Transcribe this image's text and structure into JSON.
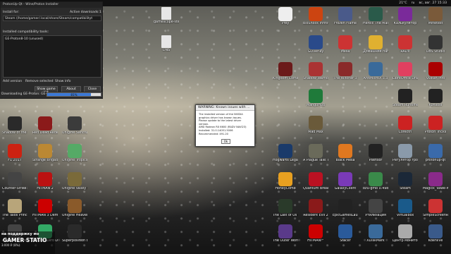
{
  "topbar": {
    "temp": "21°C",
    "lang": "ru",
    "datetime": "вс, авг. 27 15:33"
  },
  "installer": {
    "title": "ProtonUp-Qt - Wine/Proton Installer",
    "install_for_label": "Install for:",
    "install_for_value": "Steam (/home/gamer/.local/share/Steam/compatibilityt",
    "active_downloads_label": "Active downloads:",
    "active_downloads_value": "1",
    "installed_label": "Installed compatibility tools:",
    "installed_items": [
      "GE-Proton8-10 (unused)"
    ],
    "buttons": {
      "add": "Add version",
      "remove": "Remove selected",
      "info": "Show info",
      "game_list": "Show game list",
      "about": "About",
      "close": "Close"
    },
    "progress": {
      "text": "Downloading GE-Proton: GE-Pro",
      "percent": "81%",
      "value": 0.81
    }
  },
  "dialog": {
    "title": "WARNING: Known issues with ...",
    "body_1": "The installed version of the NVIDIA graphics driver has known issues.",
    "body_2": "Please update to the latest driver version.",
    "body_3": "AMD Radeon RX 6600 (RADV NAVI23)",
    "body_4": "Installed: 31.0.14051.5006",
    "body_5": "Recommended: 491.20",
    "ok": "Ok"
  },
  "files": [
    "gamescope-steam",
    "DNS"
  ],
  "icons_left": [
    {
      "label": "Shadow of the Tomb Raider",
      "color": "#2a2a2a"
    },
    {
      "label": "Red Dead Redemption 2",
      "color": "#8b1a1a"
    },
    {
      "label": "Unigine Sanctuary Benchmark",
      "color": "#3b3b3b"
    },
    {
      "label": "F1 2017",
      "color": "#c21"
    },
    {
      "label": "Strange Brigade",
      "color": "#b83"
    },
    {
      "label": "Unigine Tropics Benchmark",
      "color": "#5a6"
    },
    {
      "label": "Counter-Strike: Global Offensive",
      "color": "#444"
    },
    {
      "label": "HITMAN 2",
      "color": "#b11"
    },
    {
      "label": "Unigine Valley Benchmark",
      "color": "#7a6a3a"
    },
    {
      "label": "The Talos Principle",
      "color": "#b8a57a"
    },
    {
      "label": "HITMAN 3 Demo",
      "color": "#c00"
    },
    {
      "label": "Unigine Heaven Benchmark",
      "color": "#8a5a2a"
    },
    {
      "label": "Assassin's Creed Origins",
      "color": "#444"
    },
    {
      "label": "Horizon Zero Dawn",
      "color": "#3a6"
    },
    {
      "label": "Superposition Benchmark",
      "color": "#2a2a2a"
    }
  ],
  "icons_mid": [
    {
      "label": "Prey",
      "color": "#eee"
    },
    {
      "label": "BioShock Infinite",
      "color": "#c41"
    },
    {
      "label": "Frozen Flame",
      "color": "#4a5a8a"
    },
    {
      "label": "GOverlay",
      "color": "#2a4a8a"
    },
    {
      "label": "Mesa",
      "color": "#c33"
    },
    {
      "label": "Kingdom Come: Deliverance",
      "color": "#6b1a1a"
    },
    {
      "label": "Shadow Warrior 2",
      "color": "#a33"
    },
    {
      "label": "The Witcher 3",
      "color": "#8a2a2a"
    },
    {
      "label": "MangoHud",
      "color": "#1f7a3a"
    },
    {
      "label": "Mad Max",
      "color": "#6a5a3a"
    },
    {
      "label": "Hogwarts Legacy",
      "color": "#1a3a6a"
    },
    {
      "label": "A Plague Tale: Innocence",
      "color": "#6a6a5a"
    },
    {
      "label": "Black Mesa",
      "color": "#e07820"
    },
    {
      "label": "HoneyComb",
      "color": "#e8a020"
    },
    {
      "label": "Quantum Break",
      "color": "#b12"
    },
    {
      "label": "GalaxyClient",
      "color": "#7a3ab8"
    },
    {
      "label": "The Last of Us Part I",
      "color": "#2a3a2a"
    },
    {
      "label": "Resident Evil 2",
      "color": "#8a1a1a"
    },
    {
      "label": "EpicGamesLauncher",
      "color": "#222"
    },
    {
      "label": "The Outer Worlds: Spacer's",
      "color": "#5a3a8a"
    },
    {
      "label": "HITMAN™",
      "color": "#c00"
    },
    {
      "label": "Stacer",
      "color": "#2a5a9a"
    }
  ],
  "icons_right": [
    {
      "label": "Heroic The Master Chief Collection",
      "color": "#2a5a4a"
    },
    {
      "label": "Калькулятор",
      "color": "#7a2a9a"
    },
    {
      "label": "Minetest",
      "color": "#7a5a3a"
    },
    {
      "label": "Домашняя папка",
      "color": "#e0b030"
    },
    {
      "label": "RADV",
      "color": "#c33"
    },
    {
      "label": "OBS Studio",
      "color": "#333"
    },
    {
      "label": "AntiMicroX 3.3",
      "color": "#3a6a9a"
    },
    {
      "label": "LibreOffice Draw",
      "color": "#e04060"
    },
    {
      "label": "Vulkan Info",
      "color": "#a00"
    },
    {
      "label": "Steam Runtime",
      "color": "#222"
    },
    {
      "label": "Konsole",
      "color": "#222"
    },
    {
      "label": "Corectrl",
      "color": "#c22"
    },
    {
      "label": "Proton Tricks",
      "color": "#c22"
    },
    {
      "label": "Psensor",
      "color": "#222"
    },
    {
      "label": "Регулятор громкости PulseAudio",
      "color": "#8a9aaa"
    },
    {
      "label": "protonup-qt",
      "color": "#3a6aaa"
    },
    {
      "label": "bzu-gmb 0.498-beta",
      "color": "#3a8a4a"
    },
    {
      "label": "Steam",
      "color": "#1b2838"
    },
    {
      "label": "Magick_Vawe-wine",
      "color": "#8a2a8a"
    },
    {
      "label": "Virtualbox",
      "color": "#1a5a8a"
    },
    {
      "label": "SimpleScreenRecorder",
      "color": "#c33"
    },
    {
      "label": "Центр мониторинга",
      "color": "#aaa"
    },
    {
      "label": "XDiskMark",
      "color": "#3a6a9a"
    },
    {
      "label": "Kdenlive",
      "color": "#3a5a8a"
    },
    {
      "label": "Утилизация",
      "color": "#444"
    }
  ],
  "banner": {
    "line1": "на поддержку мо",
    "line2": "GAMER STATIO",
    "line3": "3 000 ₽ (8%)"
  }
}
